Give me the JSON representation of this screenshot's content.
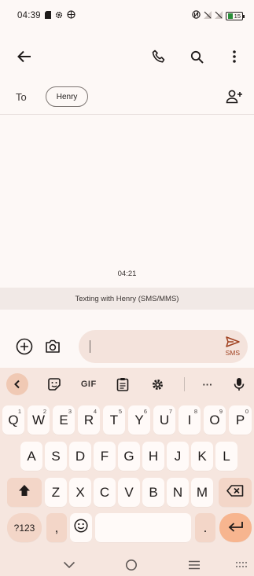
{
  "status_bar": {
    "time": "04:39",
    "battery_level": "15"
  },
  "app_bar": {
    "back_icon": "arrow-back-icon",
    "call_icon": "phone-icon",
    "search_icon": "search-icon",
    "more_icon": "more-vert-icon"
  },
  "recipients": {
    "to_label": "To",
    "chips": [
      "Henry"
    ],
    "add_contact_icon": "add-person-icon"
  },
  "conversation": {
    "timestamp": "04:21",
    "banner": "Texting with Henry (SMS/MMS)"
  },
  "compose": {
    "input_value": "",
    "send_label": "SMS",
    "accent": "#a0401f"
  },
  "keyboard": {
    "toolbar": {
      "gif_label": "GIF",
      "more_label": "···"
    },
    "row1": [
      {
        "key": "Q",
        "hint": "1"
      },
      {
        "key": "W",
        "hint": "2"
      },
      {
        "key": "E",
        "hint": "3"
      },
      {
        "key": "R",
        "hint": "4"
      },
      {
        "key": "T",
        "hint": "5"
      },
      {
        "key": "Y",
        "hint": "6"
      },
      {
        "key": "U",
        "hint": "7"
      },
      {
        "key": "I",
        "hint": "8"
      },
      {
        "key": "O",
        "hint": "9"
      },
      {
        "key": "P",
        "hint": "0"
      }
    ],
    "row2": [
      "A",
      "S",
      "D",
      "F",
      "G",
      "H",
      "J",
      "K",
      "L"
    ],
    "row3": [
      "Z",
      "X",
      "C",
      "V",
      "B",
      "N",
      "M"
    ],
    "row4": {
      "symbols_label": "?123",
      "comma_label": ",",
      "period_label": "."
    },
    "colors": {
      "background": "#f6e6df",
      "key": "#fffaf8",
      "function_key": "#f3d6c8",
      "enter_key": "#f7b58f"
    }
  },
  "nav_bar": {
    "back_icon": "chevron-down-icon",
    "home_icon": "home-circle-icon",
    "recents_icon": "menu-lines-icon",
    "keyboard_icon": "keyboard-grid-icon"
  }
}
